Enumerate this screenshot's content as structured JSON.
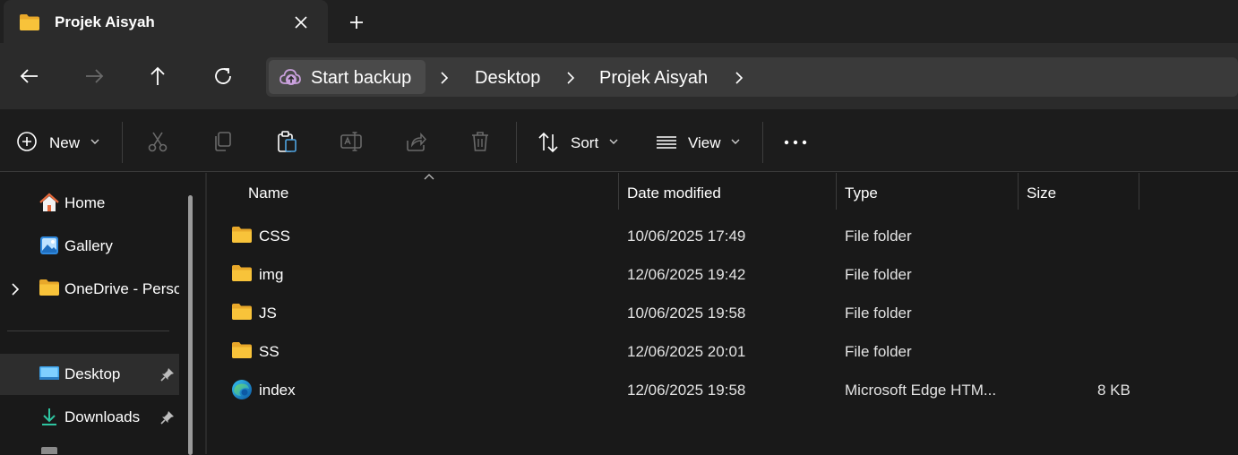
{
  "window": {
    "tab_title": "Projek Aisyah",
    "colors": {
      "background": "#191919",
      "folder": "#f8c33a",
      "backup_icon": "#c9a0dc"
    }
  },
  "navigation": {
    "back": "arrow-left-icon",
    "forward": "arrow-right-icon",
    "up": "arrow-up-icon",
    "refresh": "refresh-icon"
  },
  "address_bar": {
    "backup_label": "Start backup",
    "breadcrumbs": [
      "Desktop",
      "Projek Aisyah"
    ]
  },
  "toolbar": {
    "new_label": "New",
    "sort_label": "Sort",
    "view_label": "View"
  },
  "sidebar": {
    "items": [
      {
        "label": "Home"
      },
      {
        "label": "Gallery"
      },
      {
        "label": "OneDrive - Perso"
      },
      {
        "label": "Desktop"
      },
      {
        "label": "Downloads"
      }
    ]
  },
  "file_list": {
    "columns": {
      "name": "Name",
      "date": "Date modified",
      "type": "Type",
      "size": "Size"
    },
    "rows": [
      {
        "name": "CSS",
        "date": "10/06/2025 17:49",
        "type": "File folder",
        "size": ""
      },
      {
        "name": "img",
        "date": "12/06/2025 19:42",
        "type": "File folder",
        "size": ""
      },
      {
        "name": "JS",
        "date": "10/06/2025 19:58",
        "type": "File folder",
        "size": ""
      },
      {
        "name": "SS",
        "date": "12/06/2025 20:01",
        "type": "File folder",
        "size": ""
      },
      {
        "name": "index",
        "date": "12/06/2025 19:58",
        "type": "Microsoft Edge HTM...",
        "size": "8 KB"
      }
    ]
  }
}
